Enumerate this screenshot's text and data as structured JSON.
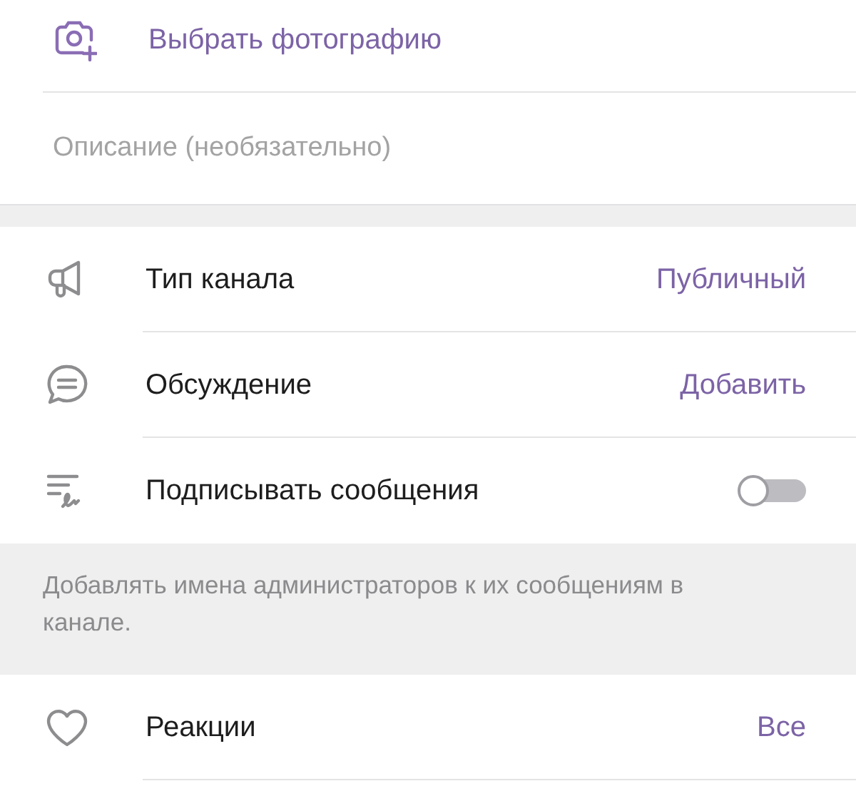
{
  "photo_action": {
    "label": "Выбрать фотографию"
  },
  "description": {
    "placeholder": "Описание (необязательно)"
  },
  "settings": [
    {
      "kind": "value",
      "label": "Тип канала",
      "value": "Публичный"
    },
    {
      "kind": "value",
      "label": "Обсуждение",
      "value": "Добавить"
    },
    {
      "kind": "toggle",
      "label": "Подписывать сообщения",
      "on": false
    }
  ],
  "settings_hint": "Добавлять имена администраторов к их сообщениям в канале.",
  "reactions": [
    {
      "kind": "value",
      "label": "Реакции",
      "value": "Все"
    }
  ]
}
